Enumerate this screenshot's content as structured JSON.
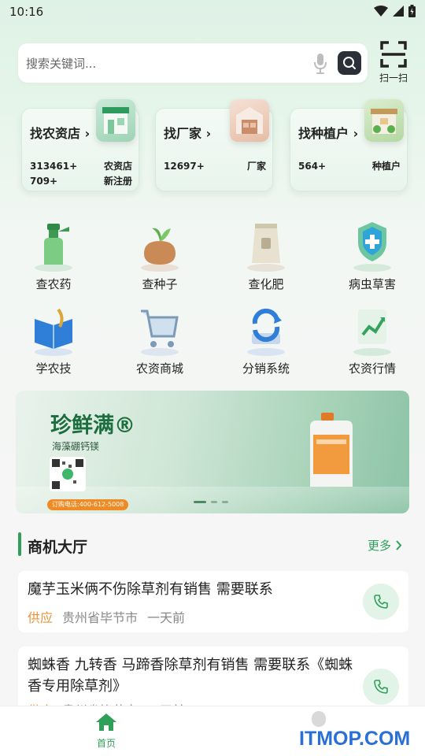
{
  "status": {
    "time": "10:16"
  },
  "search": {
    "placeholder": "搜索关键词..."
  },
  "scan": {
    "label": "扫一扫"
  },
  "find_cards": [
    {
      "title": "找农资店",
      "stats": [
        {
          "value": "313461+",
          "label": "农资店"
        },
        {
          "value": "709+",
          "label": "新注册"
        }
      ]
    },
    {
      "title": "找厂家",
      "stats": [
        {
          "value": "12697+",
          "label": "厂家"
        }
      ]
    },
    {
      "title": "找种植户",
      "stats": [
        {
          "value": "564+",
          "label": "种植户"
        }
      ]
    }
  ],
  "features": [
    {
      "label": "查农药",
      "icon": "pesticide-spray-icon"
    },
    {
      "label": "查种子",
      "icon": "seed-bag-icon"
    },
    {
      "label": "查化肥",
      "icon": "fertilizer-bag-icon"
    },
    {
      "label": "病虫草害",
      "icon": "plant-shield-icon"
    },
    {
      "label": "学农技",
      "icon": "book-icon"
    },
    {
      "label": "农资商城",
      "icon": "shopping-cart-icon"
    },
    {
      "label": "分销系统",
      "icon": "refresh-cycle-icon"
    },
    {
      "label": "农资行情",
      "icon": "trend-chart-icon"
    }
  ],
  "banner": {
    "title": "珍鲜满®",
    "subtitle": "海藻硼钙镁",
    "phone": "订购电话:400-612-5008",
    "slides": 3,
    "active_slide": 1
  },
  "section": {
    "title": "商机大厅",
    "more": "更多"
  },
  "posts": [
    {
      "title": "魔芋玉米俩不伤除草剂有销售 需要联系",
      "type": "供应",
      "location": "贵州省毕节市",
      "time": "一天前"
    },
    {
      "title": "蜘蛛香 九转香 马蹄香除草剂有销售 需要联系《蜘蛛香专用除草剂》",
      "type": "供应",
      "location": "贵州省毕节市",
      "time": "一天前"
    }
  ],
  "tabbar": {
    "home": "首页"
  },
  "watermark": "ITMOP.COM",
  "colors": {
    "accent": "#2fa05a",
    "supply": "#e8943a",
    "search_button": "#2b2f38"
  }
}
